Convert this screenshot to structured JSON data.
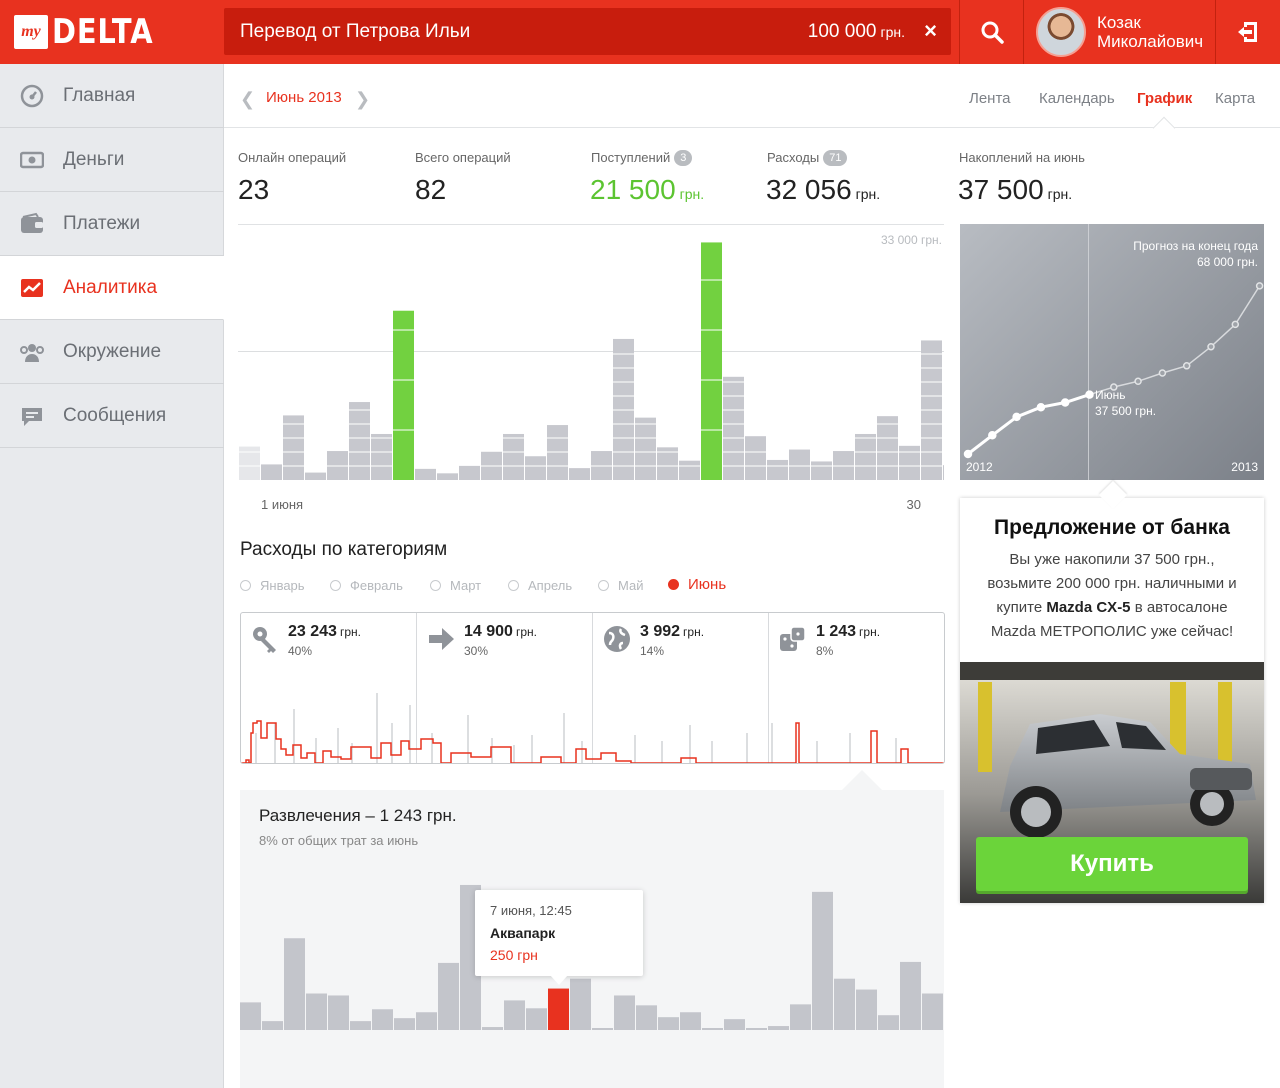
{
  "header": {
    "logo_prefix": "my",
    "logo_word": "DELTA",
    "search_text": "Перевод от Петрова Ильи",
    "search_amount": "100 000",
    "search_currency": "грн.",
    "clear_symbol": "×",
    "user_first": "Козак",
    "user_last": "Миколайович",
    "accent": "#e8321f"
  },
  "sidebar": {
    "items": [
      {
        "label": "Главная",
        "icon": "dashboard-icon"
      },
      {
        "label": "Деньги",
        "icon": "money-icon"
      },
      {
        "label": "Платежи",
        "icon": "wallet-icon"
      },
      {
        "label": "Аналитика",
        "icon": "trend-icon",
        "active": true
      },
      {
        "label": "Окружение",
        "icon": "people-icon"
      },
      {
        "label": "Сообщения",
        "icon": "chat-icon"
      }
    ]
  },
  "subheader": {
    "month": "Июнь 2013",
    "tabs": [
      "Лента",
      "Календарь",
      "График",
      "Карта"
    ],
    "active_tab": "График"
  },
  "stats": {
    "online_label": "Онлайн операций",
    "online_value": "23",
    "total_label": "Всего операций",
    "total_value": "82",
    "income_label": "Поступлений",
    "income_badge": "3",
    "income_value": "21 500",
    "income_currency": "грн.",
    "expense_label": "Расходы",
    "expense_badge": "71",
    "expense_value": "32 056",
    "expense_currency": "грн.",
    "savings_label": "Накоплений на июнь",
    "savings_value": "37 500",
    "savings_currency": "грн."
  },
  "chart_data": [
    {
      "type": "bar",
      "name": "daily",
      "ymax_label": "33 000 грн.",
      "ylim": [
        0,
        33000
      ],
      "x_start_label": "1 июня",
      "x_end_label": "30",
      "values": [
        4500,
        2100,
        8700,
        1000,
        3900,
        10500,
        6200,
        22800,
        1500,
        900,
        1900,
        3800,
        6200,
        3200,
        7400,
        1600,
        3900,
        19000,
        8400,
        4400,
        2600,
        32000,
        13900,
        5900,
        2700,
        4100,
        2500,
        3900,
        6200,
        8600,
        4600,
        18800,
        2000,
        5600
      ],
      "green": [
        7,
        21
      ],
      "green_color": "#72d140",
      "bar_color": "#c7c8ce"
    },
    {
      "type": "line",
      "name": "forecast",
      "x": [
        "2012",
        "",
        "",
        "",
        "",
        "Июнь",
        "",
        "",
        "",
        "",
        "",
        "",
        ""
      ],
      "values": [
        0,
        5200,
        10300,
        13000,
        14300,
        16500,
        18600,
        20200,
        22500,
        24500,
        29800,
        36000,
        46700
      ],
      "annotation_end": "Прогноз на конец года",
      "annotation_end_value": "68 000 грн.",
      "annotation_mid": "Июнь",
      "annotation_mid_value": "37 500 грн.",
      "x_start_label": "2012",
      "x_end_label": "2013"
    },
    {
      "type": "bar",
      "name": "entertainment",
      "ylim": [
        0,
        150
      ],
      "values": [
        28,
        9,
        93,
        37,
        35,
        9,
        21,
        12,
        18,
        68,
        147,
        3,
        30,
        22,
        42,
        52,
        0,
        35,
        25,
        13,
        18,
        2,
        11,
        0,
        4,
        26,
        140,
        52,
        41,
        15,
        69,
        37,
        9,
        21
      ],
      "highlight": 14,
      "highlight_color": "#e8321f"
    }
  ],
  "categories": {
    "title": "Расходы по категориям",
    "months": [
      "Январь",
      "Февраль",
      "Март",
      "Апрель",
      "Май",
      "Июнь"
    ],
    "selected": "Июнь",
    "items": [
      {
        "amount": "23 243",
        "currency": "грн.",
        "pct": "40%",
        "icon": "key-icon"
      },
      {
        "amount": "14 900",
        "currency": "грн.",
        "pct": "30%",
        "icon": "arrow-right-icon"
      },
      {
        "amount": "3 992",
        "currency": "грн.",
        "pct": "14%",
        "icon": "globe-icon"
      },
      {
        "amount": "1 243",
        "currency": "грн.",
        "pct": "8%",
        "icon": "dice-icon"
      }
    ]
  },
  "detail": {
    "title": "Развлечения – 1 243 грн.",
    "subtitle": "8% от общих трат за июнь",
    "tooltip_date": "7 июня, 12:45",
    "tooltip_name": "Аквапарк",
    "tooltip_amount": "250 грн"
  },
  "offer": {
    "title": "Предложение от банка",
    "text1": "Вы уже накопили 37 500 грн., возьмите 200 000 грн. наличными и купите ",
    "text_bold": "Mazda CX-5",
    "text2": " в автосалоне Mazda МЕТРОПОЛИС уже сейчас!",
    "button": "Купить",
    "button_color": "#6bd43a"
  }
}
